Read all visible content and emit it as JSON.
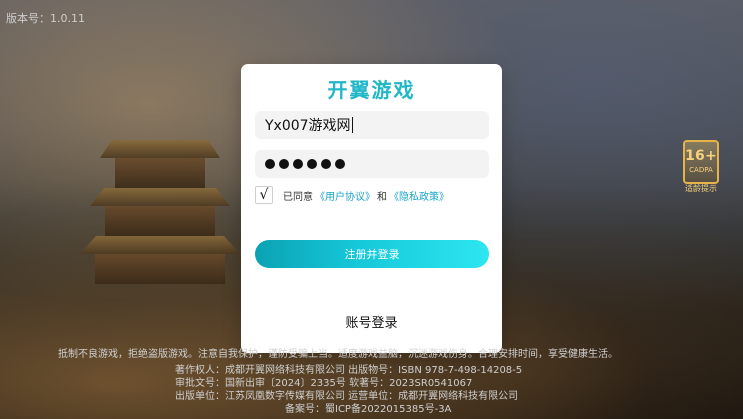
{
  "version": "版本号：1.0.11",
  "age_badge": {
    "rating": "16+",
    "small": "CADPA",
    "foot": "适龄提示"
  },
  "modal": {
    "title": "开翼游戏",
    "username_value": "Yx007游戏网",
    "password_mask": "●●●●●●",
    "agree": {
      "checked_mark": "√",
      "prefix": "已同意",
      "user_agreement": "《用户协议》",
      "and": "和",
      "privacy_policy": "《隐私政策》"
    },
    "primary_button": "注册并登录",
    "account_login": "账号登录"
  },
  "notice": "抵制不良游戏，拒绝盗版游戏。注意自我保护，谨防受骗上当。适度游戏益脑，沉迷游戏伤身。合理安排时间，享受健康生活。",
  "footer": {
    "line1": "著作权人：成都开翼网络科技有限公司  出版物号：ISBN 978-7-498-14208-5",
    "line2": "审批文号：国新出审〔2024〕2335号  软著号：2023SR0541067",
    "line3": "出版单位：江苏凤凰数字传媒有限公司  运营单位：成都开翼网络科技有限公司",
    "line4": "备案号：蜀ICP备2022015385号-3A"
  },
  "colors": {
    "title_cyan": "#20b7c7",
    "link": "#1aa6c6",
    "button_gradient_left": "#0aa2b3",
    "button_gradient_right": "#2de6f0",
    "badge": "#e6b24a"
  },
  "icons": {
    "checkbox": "check-icon"
  }
}
